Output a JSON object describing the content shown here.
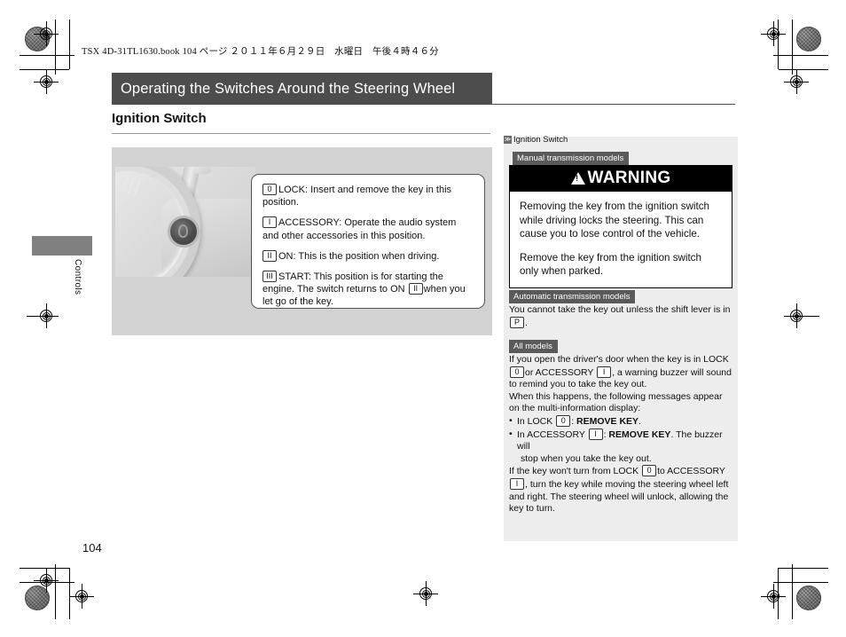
{
  "print_header": {
    "book_line": "TSX 4D-31TL1630.book   104 ページ   ２０１１年６月２９日　水曜日　午後４時４６分"
  },
  "title_bar": {
    "title": "Operating the Switches Around the Steering Wheel"
  },
  "section": {
    "heading": "Ignition Switch"
  },
  "illustration": {
    "alt": "steering-column-ignition-switch"
  },
  "callout": {
    "items": [
      {
        "key": "0",
        "text": "LOCK: Insert and remove the key in this position."
      },
      {
        "key": "I",
        "text": "ACCESSORY: Operate the audio system and other accessories in this position."
      },
      {
        "key": "II",
        "text": "ON: This is the position when driving."
      },
      {
        "key": "III",
        "text_before": "START: This position is for starting the engine. The switch returns to ON",
        "inline_key": "II",
        "text_after": "when you let go of the key."
      }
    ]
  },
  "side_tab": {
    "label": "Controls"
  },
  "folio": {
    "page_number": "104"
  },
  "sidebar": {
    "reference": {
      "marker": "≫",
      "label": "Ignition Switch"
    },
    "manual_transmission": {
      "badge": "Manual transmission models",
      "warning": {
        "title": "WARNING",
        "paragraphs": [
          "Removing the key from the ignition switch while driving locks the steering. This can cause you to lose control of the vehicle.",
          "Remove the key from the ignition switch only when parked."
        ]
      }
    },
    "automatic_transmission": {
      "badge": "Automatic transmission models",
      "text_before": "You cannot take the key out unless the shift lever is in",
      "inline_key": "P",
      "text_after": "."
    },
    "all_models": {
      "badge": "All models",
      "para1_a": "If you open the driver's door when the key is in LOCK",
      "para1_key1": "0",
      "para1_b": "or ACCESSORY",
      "para1_key2": "I",
      "para1_c": ", a warning buzzer will sound to remind you to take the key out.",
      "para2": "When this happens, the following messages appear on the multi-information display:",
      "bullets": [
        {
          "a": "In LOCK",
          "key": "0",
          "b": ":",
          "bold": "REMOVE KEY",
          "c": ".",
          "cont": ""
        },
        {
          "a": "In ACCESSORY",
          "key": "I",
          "b": ":",
          "bold": "REMOVE KEY",
          "c": ". The buzzer will",
          "cont": "stop when you take the key out."
        }
      ],
      "para3_a": "If the key won't turn from LOCK",
      "para3_key1": "0",
      "para3_b": "to ACCESSORY",
      "para3_key2": "I",
      "para3_c": ", turn the key while moving the steering wheel left and right. The steering wheel will unlock, allowing the key to turn."
    }
  },
  "colors": {
    "title_bar_bg": "#4d4d4d",
    "badge_bg": "#5a5a5a",
    "sidebar_bg": "#ededed",
    "illustration_bg": "#d2d2d2",
    "warning_bg": "#000000",
    "side_tab": "#808080"
  }
}
